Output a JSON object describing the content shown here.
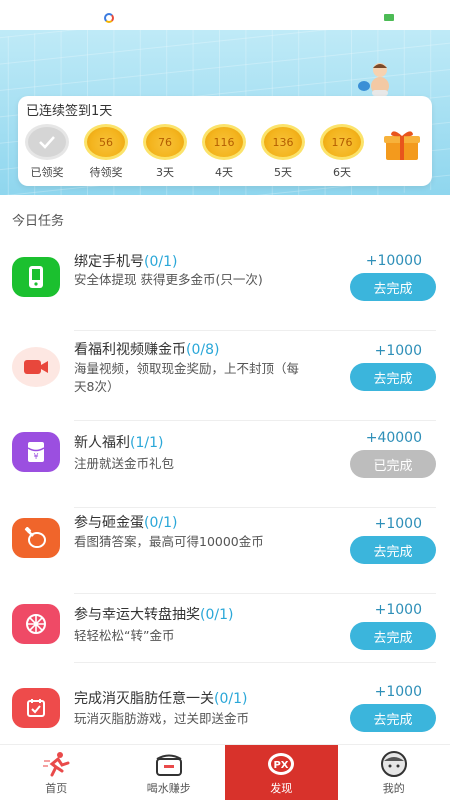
{
  "checkin": {
    "title": "已连续签到1天",
    "days": [
      {
        "value": "",
        "label": "已领奖",
        "state": "claimed"
      },
      {
        "value": "56",
        "label": "待领奖",
        "state": "pending"
      },
      {
        "value": "76",
        "label": "3天",
        "state": "future"
      },
      {
        "value": "116",
        "label": "4天",
        "state": "future"
      },
      {
        "value": "136",
        "label": "5天",
        "state": "future"
      },
      {
        "value": "176",
        "label": "6天",
        "state": "future"
      }
    ],
    "gift_icon": "gift-box-icon"
  },
  "section_title": "今日任务",
  "tasks": [
    {
      "title": "绑定手机号",
      "count": "(0/1)",
      "desc": "安全体提现 获得更多金币(只一次)",
      "reward": "+10000",
      "button": "去完成",
      "icon": "phone-icon",
      "color": "#1bc02f"
    },
    {
      "title": "看福利视频赚金币",
      "count": "(0/8)",
      "desc": "海量视频，领取现金奖励，上不封顶（每天8次）",
      "reward": "+1000",
      "button": "去完成",
      "icon": "video-camera-icon",
      "color": "#e8473c"
    },
    {
      "title": "新人福利",
      "count": "(1/1)",
      "desc": "注册就送金币礼包",
      "reward": "+40000",
      "button": "已完成",
      "icon": "red-packet-icon",
      "color": "#9b4fe0"
    },
    {
      "title": "参与砸金蛋",
      "count": "(0/1)",
      "desc": "看图猜答案，最高可得10000金币",
      "reward": "+1000",
      "button": "去完成",
      "icon": "golden-egg-icon",
      "color": "#f0652b"
    },
    {
      "title": "参与幸运大转盘抽奖",
      "count": "(0/1)",
      "desc": "轻轻松松“转”金币",
      "reward": "+1000",
      "button": "去完成",
      "icon": "lucky-wheel-icon",
      "color": "#ef4a66"
    },
    {
      "title": "完成消灭脂肪任意一关",
      "count": "(0/1)",
      "desc": "玩消灭脂肪游戏，过关即送金币",
      "reward": "+1000",
      "button": "去完成",
      "icon": "game-task-icon",
      "color": "#ee4b4b"
    }
  ],
  "nav": [
    {
      "label": "首页",
      "icon": "runner-icon"
    },
    {
      "label": "喝水赚步",
      "icon": "cup-icon"
    },
    {
      "label": "发现",
      "icon": "px-logo-icon"
    },
    {
      "label": "我的",
      "icon": "profile-avatar-icon"
    }
  ],
  "colors": {
    "accent": "#3bb5dc",
    "active_nav": "#d8322b",
    "coin": "#f4b51f"
  }
}
